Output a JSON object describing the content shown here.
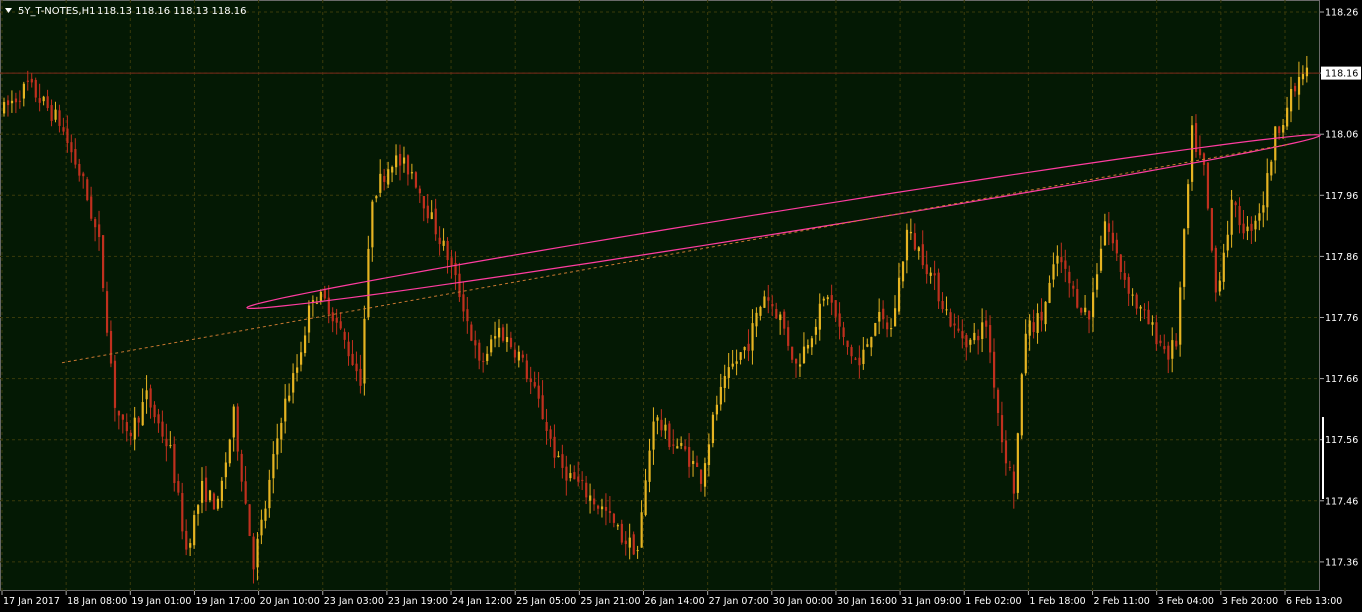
{
  "header": {
    "symbol": "5Y_T-NOTES,H1",
    "ohlc": "118.13 118.16 118.13 118.16",
    "menu_icon": "triangle-down-icon"
  },
  "colors": {
    "background": "#000000",
    "plot_background": "#041904",
    "grid": "#3a3a0a",
    "bull": "#e6b422",
    "bear": "#c0301e",
    "channel": "#ff3ca0",
    "midline": "#c87830",
    "price_line": "#7a2a1a",
    "text": "#ffffff"
  },
  "chart_data": {
    "type": "candlestick",
    "title": "5Y_T-NOTES,H1",
    "grid": true,
    "y_ticks": [
      "118.26",
      "118.16",
      "118.06",
      "117.96",
      "117.86",
      "117.76",
      "117.66",
      "117.56",
      "117.46",
      "117.36"
    ],
    "ylim": [
      117.32,
      118.28
    ],
    "x_ticks": [
      "17 Jan 2017",
      "18 Jan 08:00",
      "19 Jan 01:00",
      "19 Jan 17:00",
      "20 Jan 10:00",
      "23 Jan 03:00",
      "23 Jan 19:00",
      "24 Jan 12:00",
      "25 Jan 05:00",
      "25 Jan 21:00",
      "26 Jan 14:00",
      "27 Jan 07:00",
      "30 Jan 00:00",
      "30 Jan 16:00",
      "31 Jan 09:00",
      "1 Feb 02:00",
      "1 Feb 18:00",
      "2 Feb 11:00",
      "3 Feb 04:00",
      "3 Feb 20:00",
      "6 Feb 13:00"
    ],
    "current_price": "118.16",
    "path": [
      [
        0,
        118.1
      ],
      [
        6,
        118.14
      ],
      [
        14,
        118.08
      ],
      [
        20,
        117.98
      ],
      [
        24,
        117.88
      ],
      [
        28,
        117.62
      ],
      [
        31,
        117.56
      ],
      [
        36,
        117.63
      ],
      [
        42,
        117.54
      ],
      [
        46,
        117.38
      ],
      [
        50,
        117.48
      ],
      [
        54,
        117.45
      ],
      [
        58,
        117.6
      ],
      [
        63,
        117.36
      ],
      [
        66,
        117.45
      ],
      [
        70,
        117.6
      ],
      [
        74,
        117.68
      ],
      [
        78,
        117.8
      ],
      [
        82,
        117.78
      ],
      [
        86,
        117.72
      ],
      [
        90,
        117.66
      ],
      [
        93,
        117.96
      ],
      [
        98,
        118.02
      ],
      [
        103,
        118.0
      ],
      [
        108,
        117.92
      ],
      [
        112,
        117.86
      ],
      [
        116,
        117.78
      ],
      [
        120,
        117.68
      ],
      [
        125,
        117.74
      ],
      [
        130,
        117.7
      ],
      [
        135,
        117.62
      ],
      [
        140,
        117.52
      ],
      [
        146,
        117.48
      ],
      [
        152,
        117.44
      ],
      [
        156,
        117.4
      ],
      [
        160,
        117.38
      ],
      [
        164,
        117.6
      ],
      [
        168,
        117.56
      ],
      [
        172,
        117.54
      ],
      [
        176,
        117.5
      ],
      [
        180,
        117.62
      ],
      [
        184,
        117.68
      ],
      [
        188,
        117.72
      ],
      [
        192,
        117.8
      ],
      [
        196,
        117.76
      ],
      [
        200,
        117.68
      ],
      [
        204,
        117.74
      ],
      [
        208,
        117.8
      ],
      [
        212,
        117.72
      ],
      [
        216,
        117.68
      ],
      [
        220,
        117.76
      ],
      [
        224,
        117.74
      ],
      [
        228,
        117.9
      ],
      [
        232,
        117.86
      ],
      [
        236,
        117.8
      ],
      [
        240,
        117.74
      ],
      [
        244,
        117.72
      ],
      [
        248,
        117.75
      ],
      [
        252,
        117.56
      ],
      [
        255,
        117.48
      ],
      [
        258,
        117.74
      ],
      [
        262,
        117.76
      ],
      [
        266,
        117.86
      ],
      [
        270,
        117.8
      ],
      [
        274,
        117.76
      ],
      [
        278,
        117.92
      ],
      [
        282,
        117.84
      ],
      [
        286,
        117.78
      ],
      [
        290,
        117.74
      ],
      [
        294,
        117.7
      ],
      [
        296,
        117.72
      ],
      [
        300,
        118.06
      ],
      [
        303,
        118.0
      ],
      [
        306,
        117.8
      ],
      [
        310,
        117.94
      ],
      [
        314,
        117.9
      ],
      [
        318,
        117.95
      ],
      [
        321,
        118.06
      ],
      [
        325,
        118.12
      ],
      [
        328,
        118.16
      ]
    ],
    "channel_annotation": "ellipse"
  }
}
